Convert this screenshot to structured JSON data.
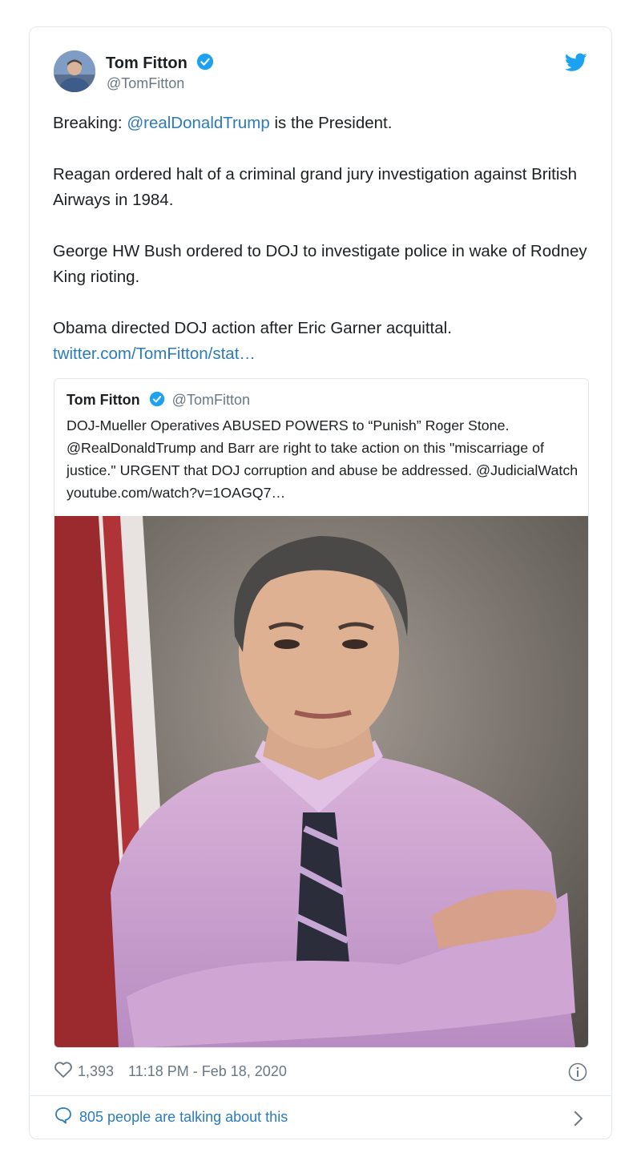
{
  "tweet": {
    "author_name": "Tom Fitton",
    "author_handle": "@TomFitton",
    "mention": "@realDonaldTrump",
    "line1_prefix": "Breaking: ",
    "line1_suffix": " is the President.",
    "para2": "Reagan ordered halt of a criminal grand jury investigation against British Airways in 1984.",
    "para3": "George HW Bush ordered to DOJ to investigate police in wake of Rodney King rioting.",
    "para4": "Obama directed DOJ action after Eric Garner acquittal.",
    "link": "twitter.com/TomFitton/stat…"
  },
  "quoted": {
    "author_name": "Tom Fitton",
    "author_handle": "@TomFitton",
    "text": "DOJ-Mueller Operatives ABUSED POWERS to “Punish” Roger Stone.  @RealDonaldTrump and Barr are right to take action on this \"miscarriage of  justice.\"  URGENT that DOJ corruption and abuse be addressed. @JudicialWatch youtube.com/watch?v=1OAGQ7…"
  },
  "footer": {
    "likes": "1,393",
    "timestamp": "11:18 PM - Feb 18, 2020",
    "conversation": "805 people are talking about this"
  },
  "icons": {
    "verified": "verified-badge-icon",
    "bird": "twitter-bird-icon",
    "like": "heart-icon",
    "info": "info-icon",
    "reply": "speech-bubble-icon",
    "chevron": "chevron-right-icon"
  },
  "colors": {
    "link": "#2b7bb9",
    "verified": "#1da1f2",
    "muted": "#697882",
    "border": "#e1e8ed"
  }
}
